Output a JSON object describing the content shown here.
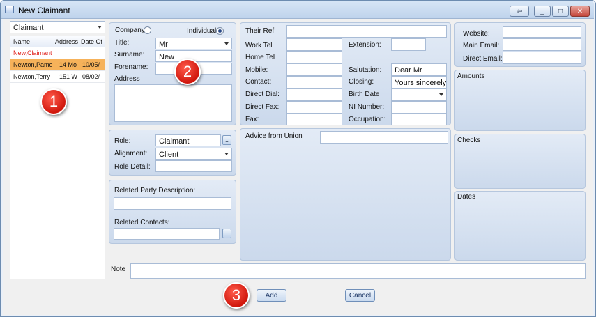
{
  "window": {
    "title": "New Claimant",
    "controls": [
      "⇦",
      "_",
      "□",
      "✕"
    ]
  },
  "left": {
    "combo_value": "Claimant",
    "columns": [
      "Name",
      "Address",
      "Date Of"
    ],
    "rows": [
      {
        "name": "New,Claimant",
        "address": "",
        "date": ""
      },
      {
        "name": "Newton,Pame",
        "address": "14 Mo",
        "date": "10/05/"
      },
      {
        "name": "Newton,Terry",
        "address": "151 W",
        "date": "08/02/"
      }
    ]
  },
  "party": {
    "company_label": "Company",
    "individual_label": "Individual",
    "title_label": "Title:",
    "title_value": "Mr",
    "surname_label": "Surname:",
    "surname_value": "New",
    "forename_label": "Forename:",
    "forename_value": "",
    "address_label": "Address"
  },
  "role": {
    "role_label": "Role:",
    "role_value": "Claimant",
    "alignment_label": "Alignment:",
    "alignment_value": "Client",
    "detail_label": "Role Detail:",
    "browse": ".."
  },
  "related": {
    "desc_label": "Related Party Description:",
    "contacts_label": "Related Contacts:",
    "browse": ".."
  },
  "contact": {
    "their_ref": "Their Ref:",
    "work_tel": "Work Tel",
    "home_tel": "Home Tel",
    "mobile": "Mobile:",
    "contact": "Contact:",
    "direct_dial": "Direct Dial:",
    "direct_fax": "Direct Fax:",
    "fax": "Fax:",
    "extension": "Extension:",
    "salutation": "Salutation:",
    "salutation_value": "Dear Mr",
    "closing": "Closing:",
    "closing_value": "Yours sincerely",
    "birth_date": "Birth Date",
    "ni_number": "NI Number:",
    "occupation": "Occupation:",
    "advice": "Advice from Union"
  },
  "right": {
    "website": "Website:",
    "main_email": "Main Email:",
    "direct_email": "Direct Email:",
    "amounts": "Amounts",
    "checks": "Checks",
    "dates": "Dates"
  },
  "note_label": "Note",
  "buttons": {
    "add": "Add",
    "cancel": "Cancel"
  },
  "callouts": [
    "1",
    "2",
    "3"
  ]
}
